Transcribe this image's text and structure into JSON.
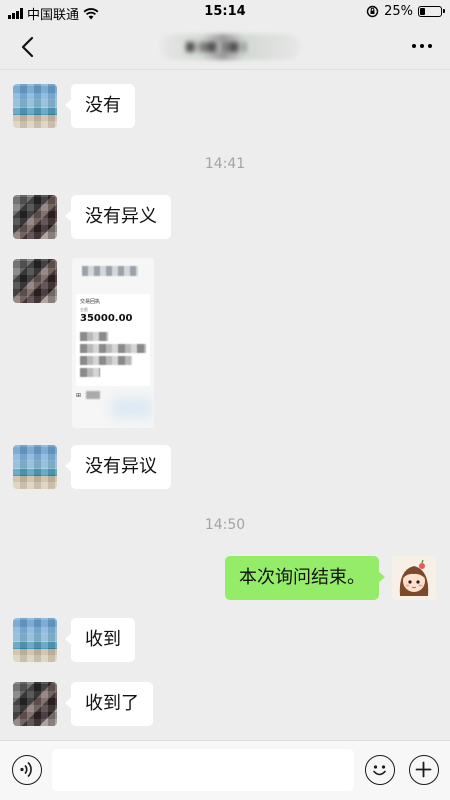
{
  "status_bar": {
    "carrier": "中国联通",
    "time": "15:14",
    "battery": "25%",
    "battery_level": 0.25,
    "wifi_icon": "wifi-icon",
    "lock_icon": "rotation-lock-icon"
  },
  "nav": {
    "back_icon": "chevron-left-icon",
    "more_icon": "more-dots-icon"
  },
  "messages": {
    "m1": "没有",
    "ts1": "14:41",
    "m2": "没有异义",
    "image_title": "交易回执",
    "image_sub": "金额",
    "image_amount": "35000.00",
    "m3": "没有异议",
    "ts2": "14:50",
    "m4": "本次询问结束。",
    "m5": "收到",
    "m6": "收到了"
  },
  "input_bar": {
    "voice_icon": "voice-icon",
    "emoji_icon": "emoji-icon",
    "plus_icon": "plus-icon",
    "input_value": ""
  },
  "colors": {
    "background": "#ededed",
    "outgoing_bubble": "#95ec69",
    "incoming_bubble": "#ffffff",
    "timestamp": "#a3a3a3"
  }
}
